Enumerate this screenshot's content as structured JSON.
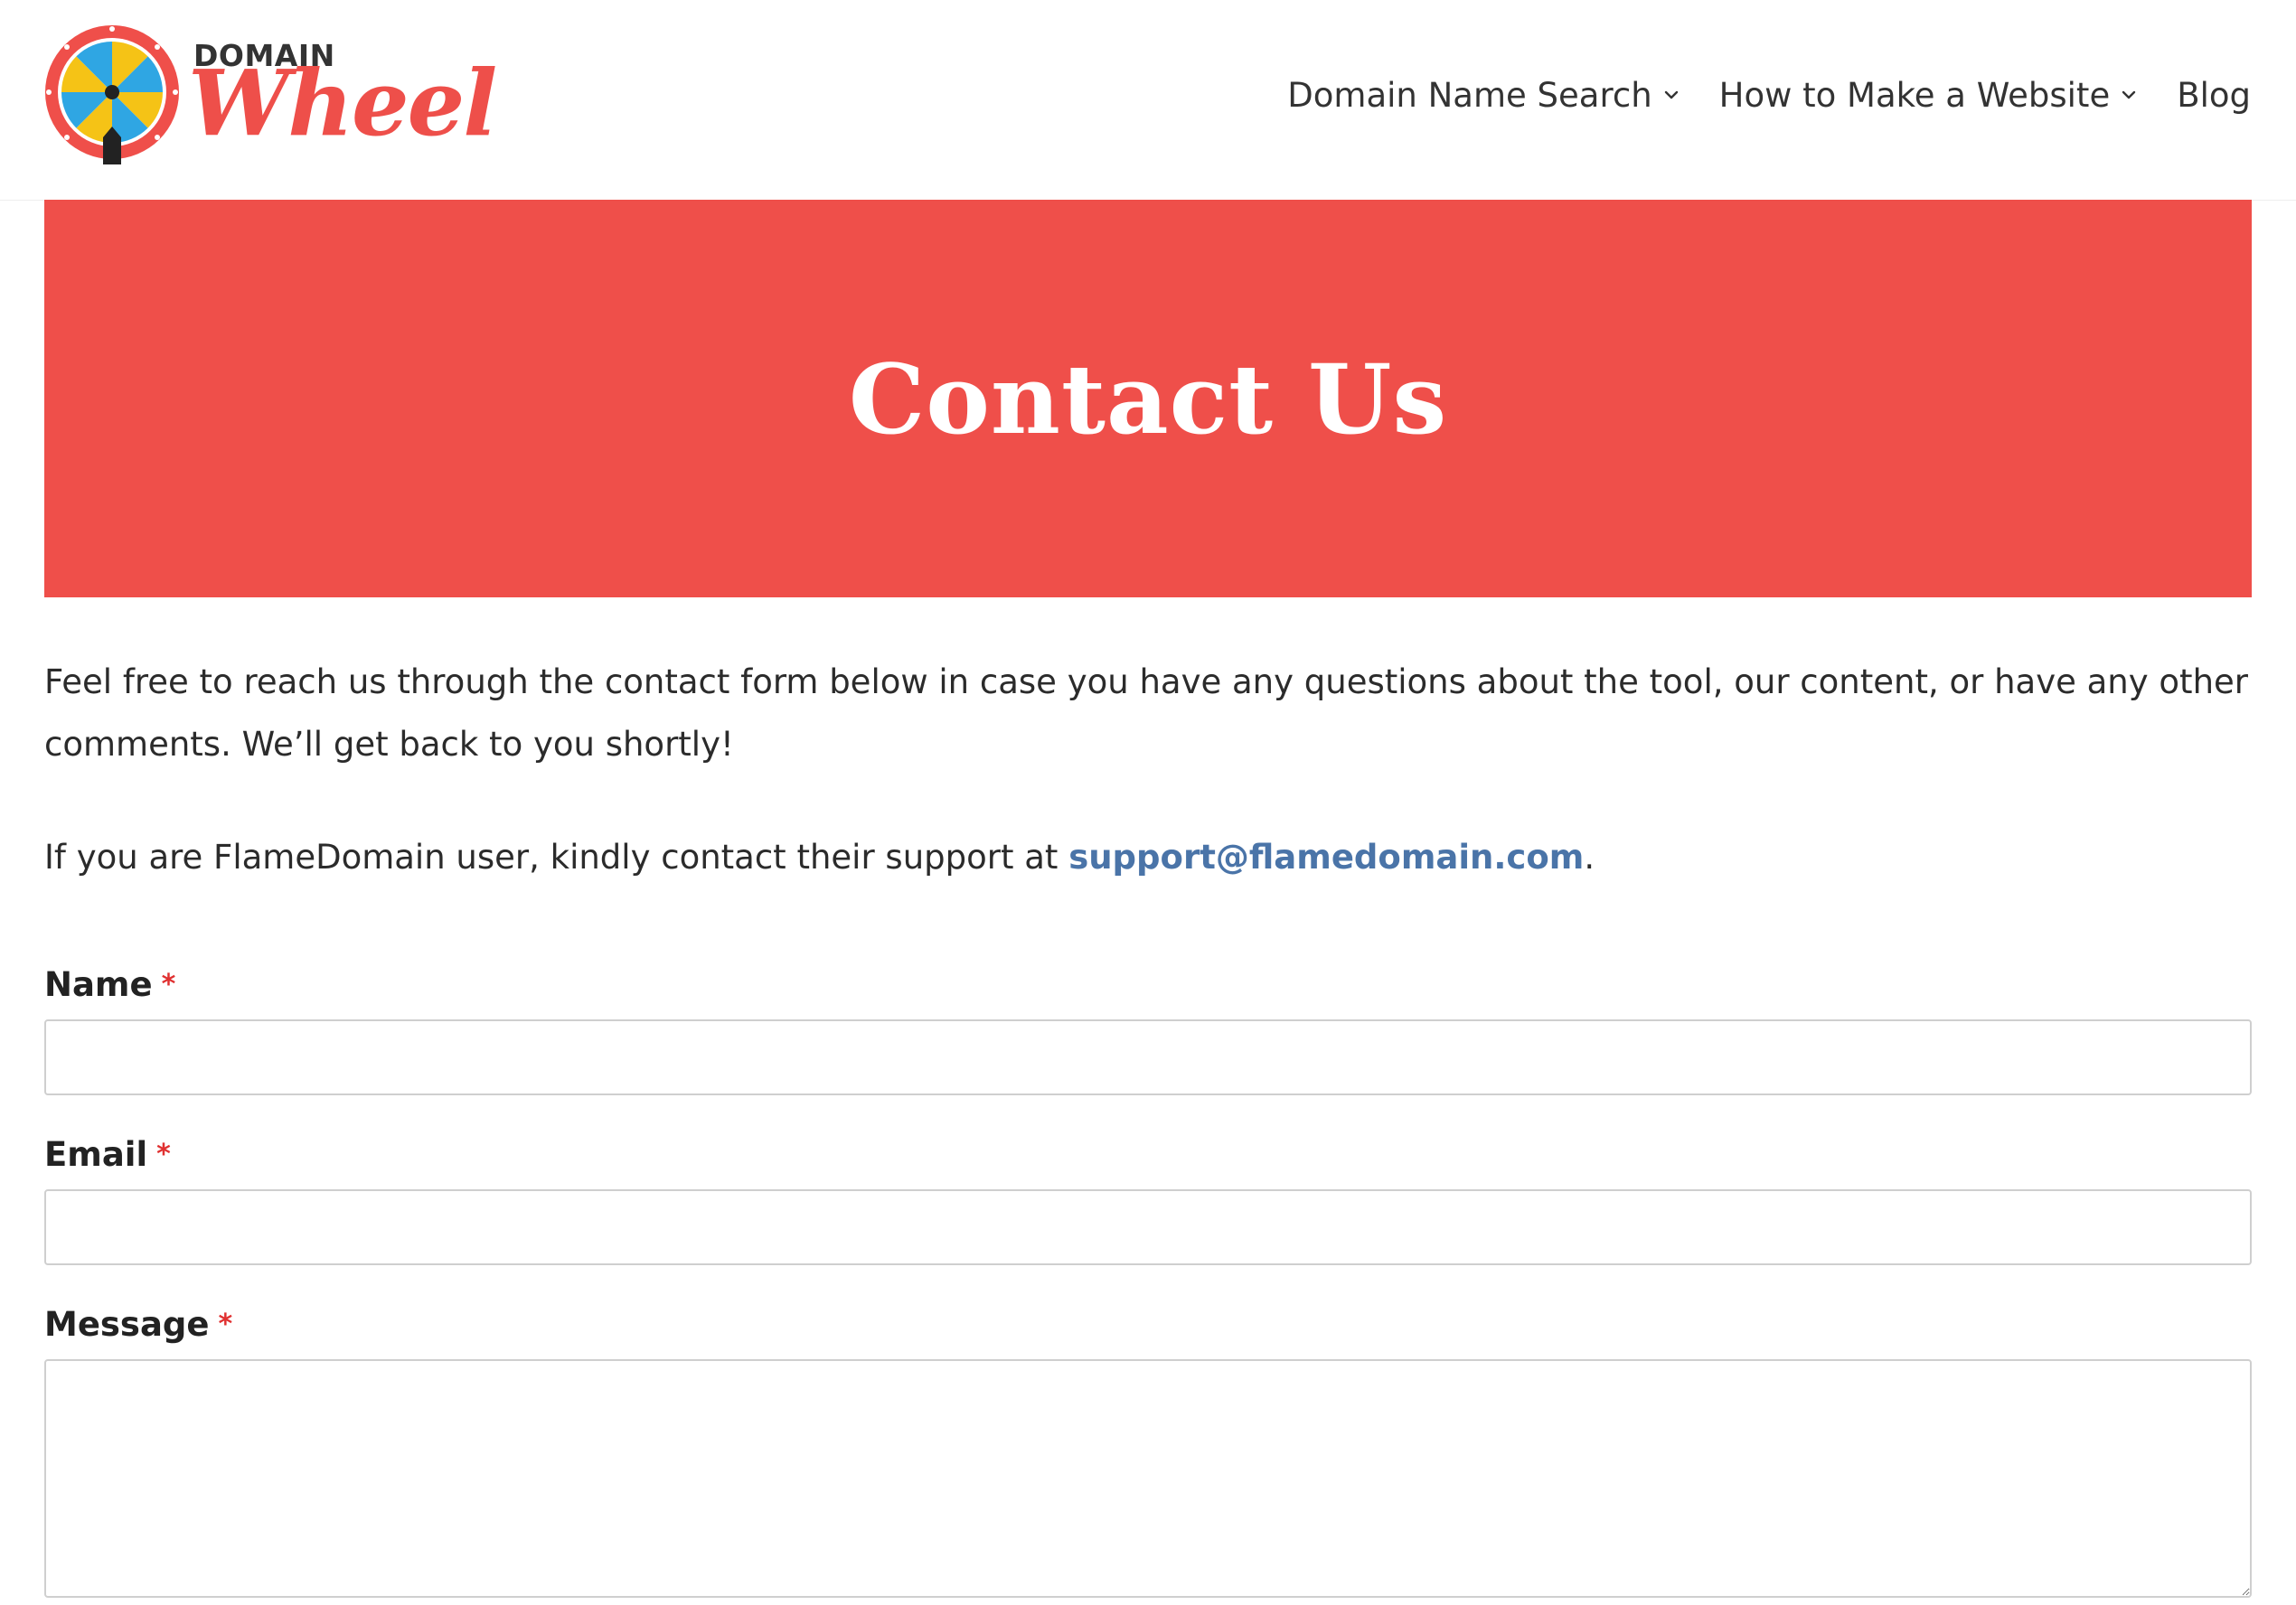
{
  "brand": {
    "name_top": "DOMAIN",
    "name_script": "Wheel",
    "primary_color": "#ef4f4a",
    "accent_yellow": "#f5c316",
    "accent_blue": "#2fa6e3"
  },
  "nav": {
    "items": [
      {
        "label": "Domain Name Search",
        "has_dropdown": true
      },
      {
        "label": "How to Make a Website",
        "has_dropdown": true
      },
      {
        "label": "Blog",
        "has_dropdown": false
      }
    ]
  },
  "hero": {
    "title": "Contact Us"
  },
  "content": {
    "intro": "Feel free to reach us through the contact form below in case you have any questions about the tool, our content, or have any other comments. We’ll get back to you shortly!",
    "support_prefix": "If you are FlameDomain user, kindly contact their support at ",
    "support_email": "support@flamedomain.com",
    "support_suffix": ".",
    "link_color": "#4a74a8"
  },
  "form": {
    "name_label": "Name",
    "email_label": "Email",
    "message_label": "Message",
    "required_mark": "*",
    "name_value": "",
    "email_value": "",
    "message_value": ""
  }
}
